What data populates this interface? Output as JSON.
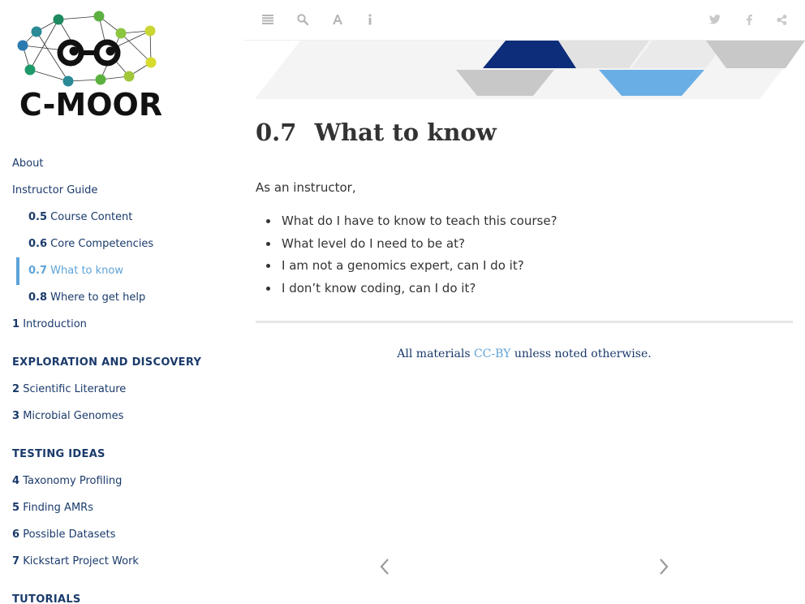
{
  "logo": {
    "text": "C-MOOR"
  },
  "sidebar": {
    "top_items": [
      {
        "label": "About"
      },
      {
        "label": "Instructor Guide"
      }
    ],
    "sub_items": [
      {
        "num": "0.5",
        "label": "Course Content"
      },
      {
        "num": "0.6",
        "label": "Core Competencies"
      },
      {
        "num": "0.7",
        "label": "What to know"
      },
      {
        "num": "0.8",
        "label": "Where to get help"
      }
    ],
    "intro": {
      "num": "1",
      "label": "Introduction"
    },
    "sections": [
      {
        "heading": "EXPLORATION AND DISCOVERY",
        "items": [
          {
            "num": "2",
            "label": "Scientific Literature"
          },
          {
            "num": "3",
            "label": "Microbial Genomes"
          }
        ]
      },
      {
        "heading": "TESTING IDEAS",
        "items": [
          {
            "num": "4",
            "label": "Taxonomy Profiling"
          },
          {
            "num": "5",
            "label": "Finding AMRs"
          },
          {
            "num": "6",
            "label": "Possible Datasets"
          },
          {
            "num": "7",
            "label": "Kickstart Project Work"
          }
        ]
      },
      {
        "heading": "TUTORIALS",
        "items": []
      }
    ]
  },
  "toolbar": {
    "left_icons": [
      "list-icon",
      "search-icon",
      "font-icon",
      "info-icon"
    ],
    "right_icons": [
      "twitter-icon",
      "facebook-icon",
      "share-icon"
    ]
  },
  "main": {
    "section_number": "0.7",
    "title": "What to know",
    "lead": "As an instructor,",
    "questions": [
      "What do I have to know to teach this course?",
      "What level do I need to be at?",
      "I am not a genomics expert, can I do it?",
      "I don’t know coding, can I do it?"
    ],
    "footer": {
      "prefix": "All materials",
      "link": "CC-BY",
      "suffix": "unless noted otherwise."
    }
  },
  "colors": {
    "navy": "#1a3a6b",
    "accent": "#5ea3d8",
    "banner_dark": "#0d2d7a",
    "banner_light": "#6aaee6",
    "banner_gray": "#c8c8c8"
  }
}
